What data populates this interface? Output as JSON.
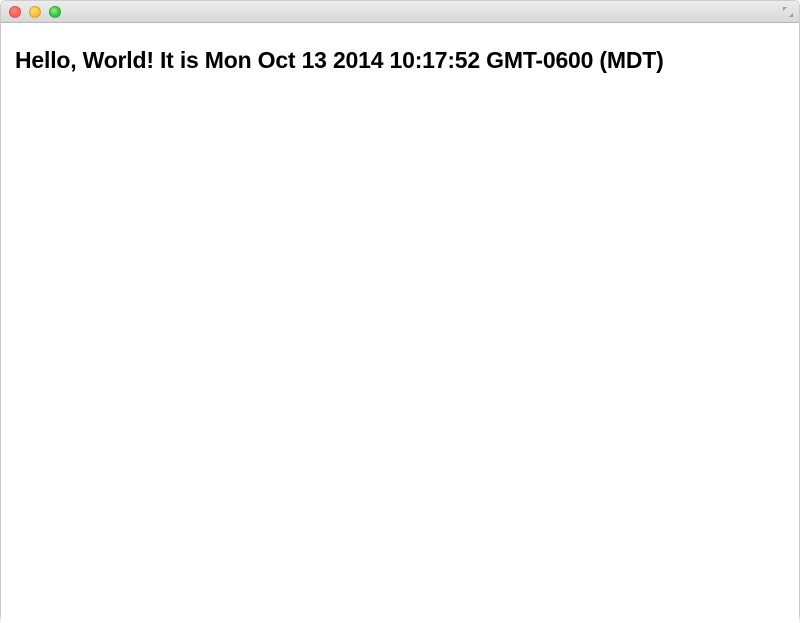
{
  "window": {
    "traffic": {
      "close": "close",
      "minimize": "minimize",
      "zoom": "zoom"
    }
  },
  "content": {
    "heading": "Hello, World! It is Mon Oct 13 2014 10:17:52 GMT-0600 (MDT)"
  }
}
